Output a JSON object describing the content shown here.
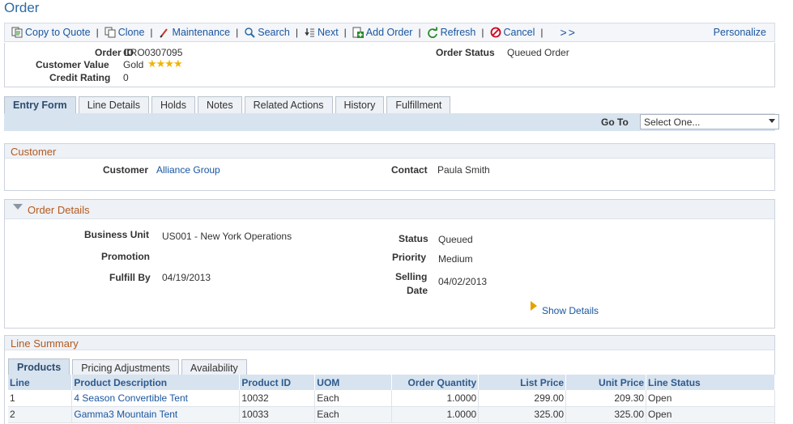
{
  "page": {
    "title": "Order"
  },
  "toolbar": {
    "items": [
      {
        "label": "Copy to Quote",
        "icon": "copy-to-quote-icon"
      },
      {
        "label": "Clone",
        "icon": "clone-icon"
      },
      {
        "label": "Maintenance",
        "icon": "maintenance-icon"
      },
      {
        "label": "Search",
        "icon": "search-icon"
      },
      {
        "label": "Next",
        "icon": "next-icon"
      },
      {
        "label": "Add Order",
        "icon": "add-order-icon"
      },
      {
        "label": "Refresh",
        "icon": "refresh-icon"
      },
      {
        "label": "Cancel",
        "icon": "cancel-icon"
      }
    ],
    "separator": "|",
    "more_label": ">>",
    "personalize_label": "Personalize"
  },
  "header": {
    "order_id_label": "Order ID",
    "order_id": "CRO0307095",
    "customer_value_label": "Customer Value",
    "customer_value": "Gold",
    "customer_value_stars": "★★★★",
    "credit_rating_label": "Credit Rating",
    "credit_rating": "0",
    "order_status_label": "Order Status",
    "order_status": "Queued Order"
  },
  "tabs": [
    "Entry Form",
    "Line Details",
    "Holds",
    "Notes",
    "Related Actions",
    "History",
    "Fulfillment"
  ],
  "goto": {
    "label": "Go To",
    "value": "Select One..."
  },
  "customer_section": {
    "title": "Customer",
    "customer_label": "Customer",
    "customer": "Alliance Group",
    "contact_label": "Contact",
    "contact": "Paula Smith"
  },
  "order_details": {
    "title": "Order Details",
    "business_unit_label": "Business Unit",
    "business_unit": "US001 - New York Operations",
    "promotion_label": "Promotion",
    "fulfill_by_label": "Fulfill By",
    "fulfill_by": "04/19/2013",
    "status_label": "Status",
    "status": "Queued",
    "priority_label": "Priority",
    "priority": "Medium",
    "selling_date_label_1": "Selling",
    "selling_date_label_2": "Date",
    "selling_date": "04/02/2013",
    "show_details_label": "Show Details"
  },
  "line_summary": {
    "title": "Line Summary",
    "tabs": [
      "Products",
      "Pricing Adjustments",
      "Availability"
    ],
    "columns": [
      "Line",
      "Product Description",
      "Product ID",
      "UOM",
      "Order Quantity",
      "List Price",
      "Unit Price",
      "Line Status"
    ],
    "rows": [
      {
        "line": "1",
        "description": "4 Season Convertible Tent",
        "product_id": "10032",
        "uom": "Each",
        "quantity": "1.0000",
        "list_price": "299.00",
        "unit_price": "209.30",
        "status": "Open"
      },
      {
        "line": "2",
        "description": "Gamma3 Mountain Tent",
        "product_id": "10033",
        "uom": "Each",
        "quantity": "1.0000",
        "list_price": "325.00",
        "unit_price": "325.00",
        "status": "Open"
      }
    ]
  },
  "colors": {
    "accent": "#1a56a0",
    "section_title": "#b35a1f",
    "tab_active": "#d7e3ef",
    "star": "#f0b400"
  }
}
